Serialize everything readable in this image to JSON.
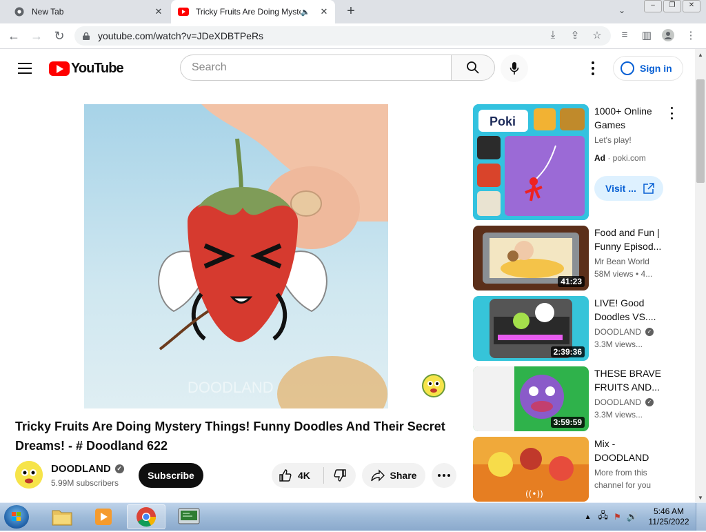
{
  "browser": {
    "tabs": [
      {
        "title": "New Tab",
        "active": false
      },
      {
        "title": "Tricky Fruits Are Doing Myste",
        "active": true
      }
    ],
    "url": "youtube.com/watch?v=JDeXDBTPeRs"
  },
  "youtube": {
    "logo_text": "YouTube",
    "search_placeholder": "Search",
    "signin_label": "Sign in",
    "video": {
      "title": "Tricky Fruits Are Doing Mystery Things! Funny Doodles And Their Secret Dreams! - # Doodland 622",
      "watermark_text": "DOODLAND",
      "channel": "DOODLAND",
      "subscribers": "5.99M subscribers",
      "subscribe_label": "Subscribe",
      "likes": "4K",
      "share_label": "Share"
    },
    "ad": {
      "title": "1000+ Online Games",
      "subtitle": "Let's play!",
      "label": "Ad",
      "domain": "poki.com",
      "visit_label": "Visit ...",
      "brand": "Poki"
    },
    "recommendations": [
      {
        "title": "Food and Fun | Funny Episod...",
        "channel": "Mr Bean World",
        "views": "58M views • 4...",
        "duration": "41:23",
        "verified": false
      },
      {
        "title": "LIVE! Good Doodles VS....",
        "channel": "DOODLAND",
        "views": "3.3M views...",
        "duration": "2:39:36",
        "verified": true
      },
      {
        "title": "THESE BRAVE FRUITS AND...",
        "channel": "DOODLAND",
        "views": "3.3M views...",
        "duration": "3:59:59",
        "verified": true
      },
      {
        "title": "Mix - DOODLAND",
        "channel": "More from this",
        "views": "channel for you",
        "duration": "",
        "verified": false
      }
    ]
  },
  "taskbar": {
    "time": "5:46 AM",
    "date": "11/25/2022"
  },
  "colors": {
    "youtube_red": "#ff0000",
    "link_blue": "#065fd4",
    "subscribe_black": "#0f0f0f"
  }
}
